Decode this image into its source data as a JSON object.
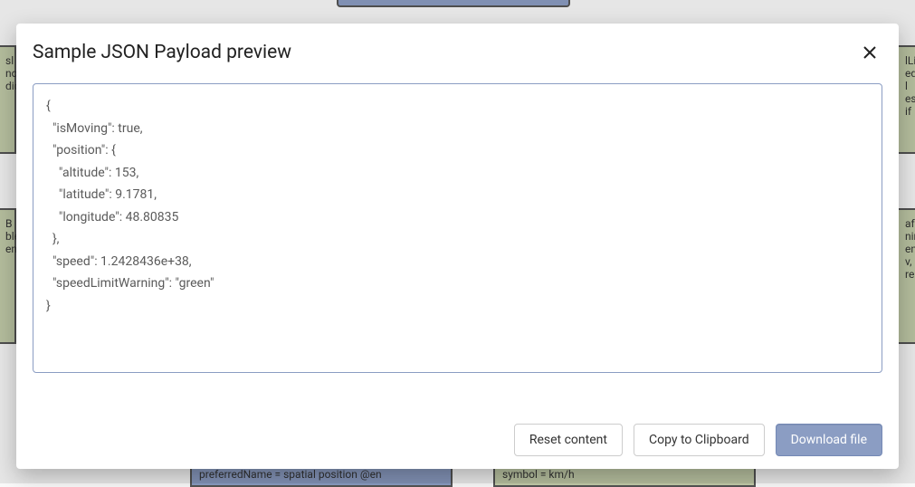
{
  "modal": {
    "title": "Sample JSON Payload preview",
    "json_text": "{\n  \"isMoving\": true,\n  \"position\": {\n    \"altitude\": 153,\n    \"latitude\": 9.1781,\n    \"longitude\": 48.80835\n  },\n  \"speed\": 1.2428436e+38,\n  \"speedLimitWarning\": \"green\"\n}",
    "buttons": {
      "reset": "Reset content",
      "copy": "Copy to Clipboard",
      "download": "Download file"
    }
  },
  "background_fragments": {
    "left_top1": "sl",
    "left_top2": "no",
    "left_top3": "dic",
    "left_mid1": "B",
    "left_mid2": "ble",
    "left_mid3": "en",
    "right_top1": "lLir",
    "right_top2": "ed l",
    "right_top3": "es if",
    "right_mid1": "aff",
    "right_mid2": "ning",
    "right_mid3": "ents",
    "right_mid4": "v, re",
    "bottom_left": "preferredName = spatial position @en",
    "bottom_right": "symbol = km/h"
  }
}
